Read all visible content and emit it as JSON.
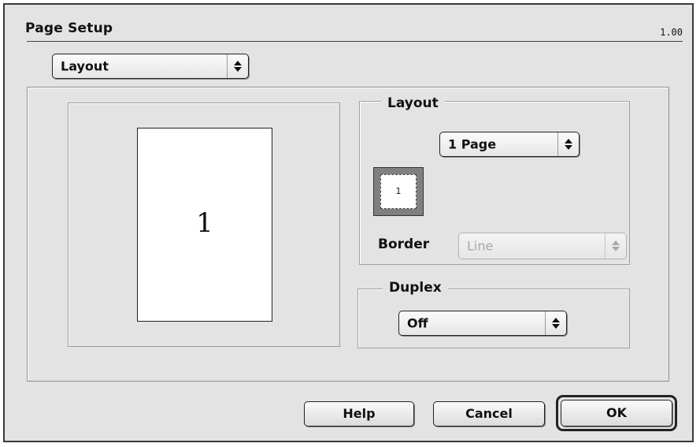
{
  "window": {
    "title": "Page Setup",
    "version": "1.00"
  },
  "settings_popup": {
    "value": "Layout"
  },
  "preview": {
    "page_number": "1"
  },
  "layout_group": {
    "title": "Layout",
    "pages_popup": {
      "value": "1 Page"
    },
    "icon_number": "1",
    "border_label": "Border",
    "border_popup": {
      "value": "Line",
      "disabled": true
    }
  },
  "duplex_group": {
    "title": "Duplex",
    "duplex_popup": {
      "value": "Off"
    }
  },
  "buttons": {
    "help": "Help",
    "cancel": "Cancel",
    "ok": "OK"
  },
  "icons": {
    "popup_arrows": "up-down-arrows-icon"
  }
}
